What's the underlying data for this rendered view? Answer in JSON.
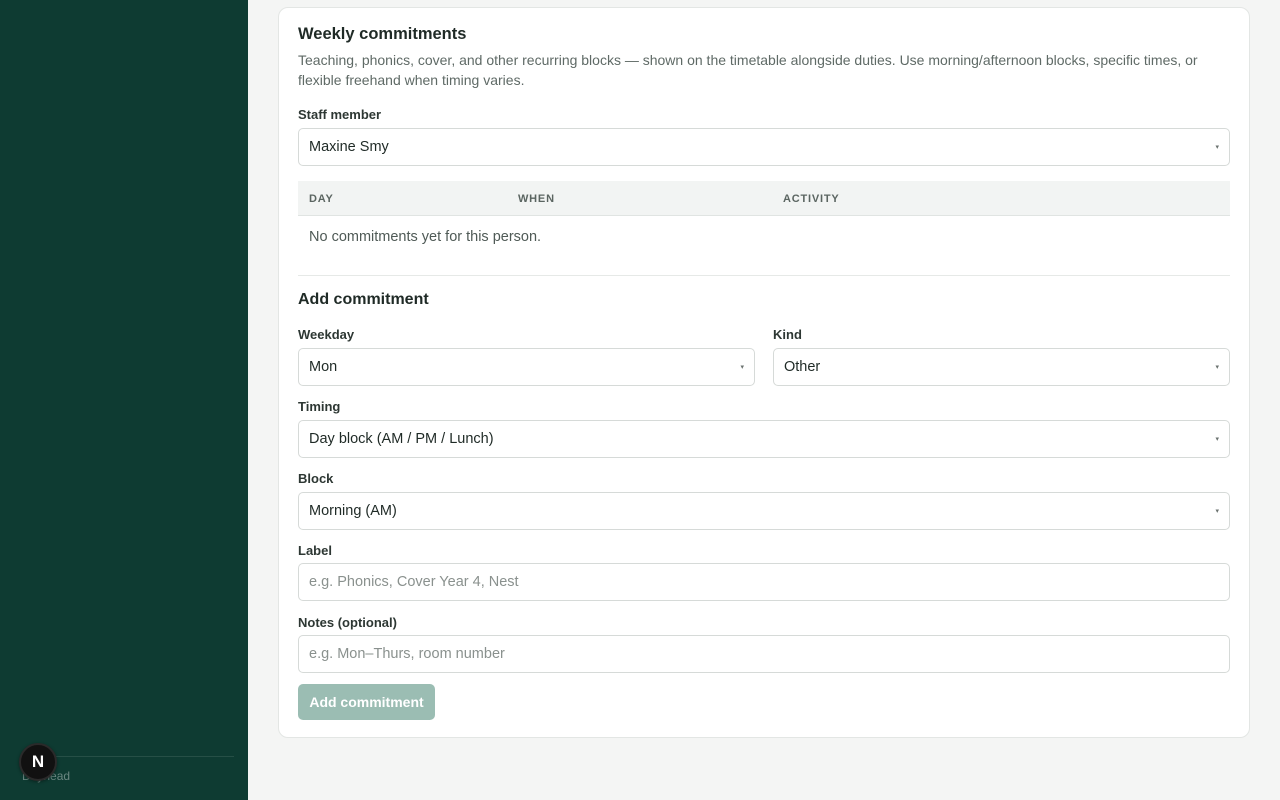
{
  "sidebar": {
    "footer_text": "Dayhead",
    "badge_letter": "N"
  },
  "card": {
    "title": "Weekly commitments",
    "description": "Teaching, phonics, cover, and other recurring blocks — shown on the timetable alongside duties. Use morning/afternoon blocks, specific times, or flexible freehand when timing varies.",
    "staff_label": "Staff member",
    "staff_value": "Maxine Smy",
    "table": {
      "columns": [
        "DAY",
        "WHEN",
        "ACTIVITY"
      ],
      "empty_text": "No commitments yet for this person."
    }
  },
  "add_form": {
    "title": "Add commitment",
    "weekday_label": "Weekday",
    "weekday_value": "Mon",
    "kind_label": "Kind",
    "kind_value": "Other",
    "timing_label": "Timing",
    "timing_value": "Day block (AM / PM / Lunch)",
    "block_label": "Block",
    "block_value": "Morning (AM)",
    "label_label": "Label",
    "label_placeholder": "e.g. Phonics, Cover Year 4, Nest",
    "notes_label": "Notes (optional)",
    "notes_placeholder": "e.g. Mon–Thurs, room number",
    "submit_label": "Add commitment"
  },
  "icons": {
    "caret": "▾"
  },
  "colors": {
    "sidebar_bg": "#0e3b32",
    "button_disabled": "#9bbdb3"
  }
}
